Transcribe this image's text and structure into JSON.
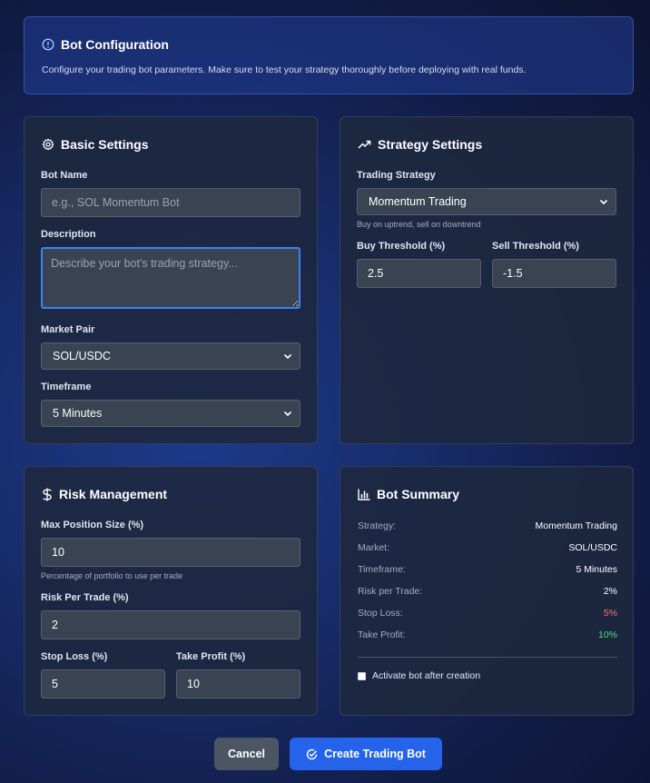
{
  "info": {
    "title": "Bot Configuration",
    "text": "Configure your trading bot parameters. Make sure to test your strategy thoroughly before deploying with real funds."
  },
  "basic": {
    "title": "Basic Settings",
    "bot_name_label": "Bot Name",
    "bot_name_placeholder": "e.g., SOL Momentum Bot",
    "bot_name_value": "",
    "description_label": "Description",
    "description_placeholder": "Describe your bot's trading strategy...",
    "market_pair_label": "Market Pair",
    "market_pair_value": "SOL/USDC",
    "timeframe_label": "Timeframe",
    "timeframe_value": "5 Minutes"
  },
  "strategy": {
    "title": "Strategy Settings",
    "trading_strategy_label": "Trading Strategy",
    "trading_strategy_value": "Momentum Trading",
    "strategy_hint": "Buy on uptrend, sell on downtrend",
    "buy_threshold_label": "Buy Threshold (%)",
    "buy_threshold_value": "2.5",
    "sell_threshold_label": "Sell Threshold (%)",
    "sell_threshold_value": "-1.5"
  },
  "risk": {
    "title": "Risk Management",
    "max_position_label": "Max Position Size (%)",
    "max_position_value": "10",
    "max_position_hint": "Percentage of portfolio to use per trade",
    "risk_per_trade_label": "Risk Per Trade (%)",
    "risk_per_trade_value": "2",
    "stop_loss_label": "Stop Loss (%)",
    "stop_loss_value": "5",
    "take_profit_label": "Take Profit (%)",
    "take_profit_value": "10"
  },
  "summary": {
    "title": "Bot Summary",
    "rows": [
      {
        "key": "Strategy:",
        "value": "Momentum Trading",
        "color": "#ffffff"
      },
      {
        "key": "Market:",
        "value": "SOL/USDC",
        "color": "#ffffff"
      },
      {
        "key": "Timeframe:",
        "value": "5 Minutes",
        "color": "#ffffff"
      },
      {
        "key": "Risk per Trade:",
        "value": "2%",
        "color": "#ffffff"
      },
      {
        "key": "Stop Loss:",
        "value": "5%",
        "color": "#f87171"
      },
      {
        "key": "Take Profit:",
        "value": "10%",
        "color": "#4ade80"
      }
    ],
    "activate_label": "Activate bot after creation"
  },
  "actions": {
    "cancel_label": "Cancel",
    "create_label": "Create Trading Bot"
  },
  "colors": {
    "accent": "#2563eb",
    "loss": "#f87171",
    "profit": "#4ade80"
  }
}
